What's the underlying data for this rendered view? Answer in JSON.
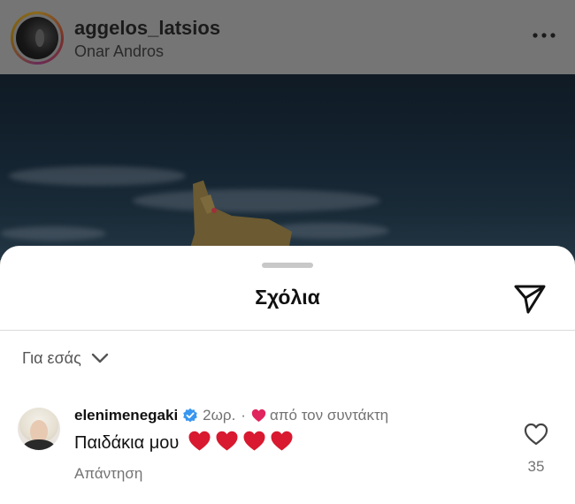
{
  "post": {
    "username": "aggelos_latsios",
    "location": "Onar Andros",
    "icons": {
      "more": "more-horizontal-icon",
      "avatar": "story-ring-avatar"
    }
  },
  "comments_sheet": {
    "title": "Σχόλια",
    "share_icon": "send-icon",
    "filter": {
      "label": "Για εσάς",
      "icon": "chevron-down-icon"
    },
    "comments": [
      {
        "username": "elenimenegaki",
        "verified": true,
        "time": "2ωρ.",
        "separator": "·",
        "liked_by_author_label": "από τον συντάκτη",
        "text": "Παιδάκια μου",
        "emoji_hearts": 4,
        "reply_label": "Απάντηση",
        "likes": "35"
      }
    ]
  },
  "colors": {
    "verified_blue": "#3897f0",
    "heart_red": "#e0245e",
    "muted_text": "#737373",
    "overlay_dim": "#6e6e6e"
  }
}
